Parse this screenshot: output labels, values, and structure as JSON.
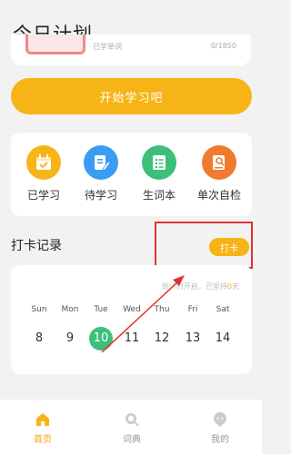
{
  "header": {
    "title": "今日计划"
  },
  "top_card": {
    "learned_label": "已学单词",
    "learned_count": "0/1850"
  },
  "start_button": {
    "label": "开始学习吧"
  },
  "features": [
    {
      "label": "已学习",
      "icon": "calendar-icon",
      "color": "#f7b416"
    },
    {
      "label": "待学习",
      "icon": "edit-note-icon",
      "color": "#3a9cf2"
    },
    {
      "label": "生词本",
      "icon": "checklist-icon",
      "color": "#3dbf7a"
    },
    {
      "label": "单次自检",
      "icon": "book-search-icon",
      "color": "#f07a2e"
    }
  ],
  "checkin": {
    "title": "打卡记录",
    "button_label": "打卡",
    "streak_prefix": "倒计时开启，已坚持",
    "streak_days": "0",
    "streak_suffix": "天"
  },
  "calendar": {
    "days": [
      {
        "name": "Sun",
        "num": "8"
      },
      {
        "name": "Mon",
        "num": "9"
      },
      {
        "name": "Tue",
        "num": "10"
      },
      {
        "name": "Wed",
        "num": "11"
      },
      {
        "name": "Thu",
        "num": "12"
      },
      {
        "name": "Fri",
        "num": "13"
      },
      {
        "name": "Sat",
        "num": "14"
      }
    ],
    "today_index": 2
  },
  "nav": [
    {
      "label": "首页",
      "icon": "home-icon",
      "active": true
    },
    {
      "label": "词典",
      "icon": "search-icon",
      "active": false
    },
    {
      "label": "我的",
      "icon": "profile-chat-icon",
      "active": false
    }
  ],
  "colors": {
    "accent": "#f7b416",
    "today": "#3dbf7a",
    "annotation": "#e53030"
  }
}
